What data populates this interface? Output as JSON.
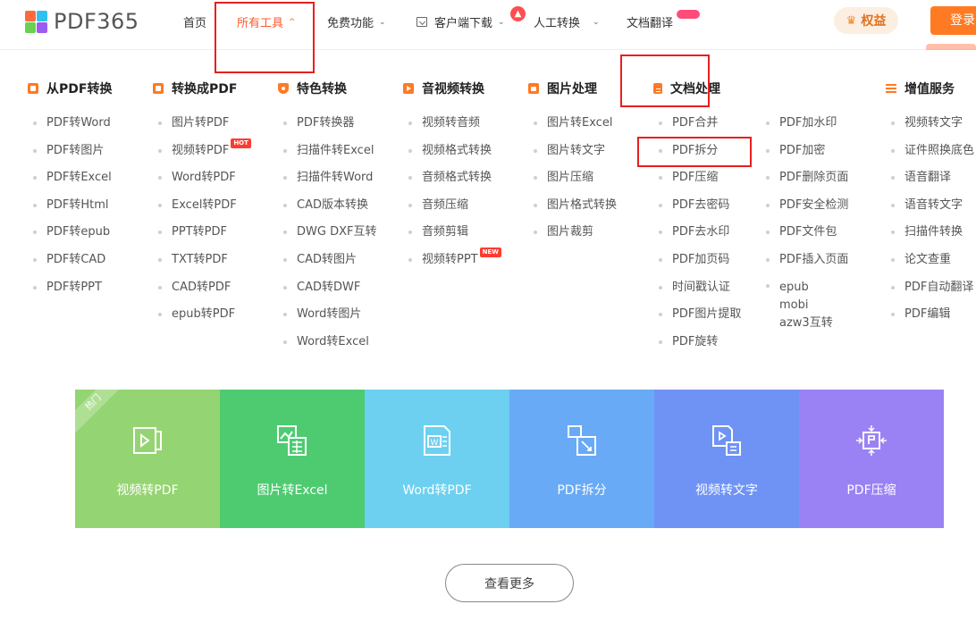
{
  "brand": {
    "name": "PDF365",
    "logo_colors": [
      "#ff6a3d",
      "#2ec1f0",
      "#6ad04e",
      "#9b5cf0"
    ]
  },
  "nav": {
    "home": "首页",
    "all_tools": "所有工具",
    "free": "免费功能",
    "client_download": "客户端下载",
    "manual": "人工转换",
    "doc_translate": "文档翻译",
    "rights": "权益",
    "login": "登录"
  },
  "categories": [
    {
      "name": "从PDF转换",
      "icon": "from-pdf-icon",
      "items": [
        "PDF转Word",
        "PDF转图片",
        "PDF转Excel",
        "PDF转Html",
        "PDF转epub",
        "PDF转CAD",
        "PDF转PPT"
      ]
    },
    {
      "name": "转换成PDF",
      "icon": "to-pdf-icon",
      "items": [
        "图片转PDF",
        "视频转PDF",
        "Word转PDF",
        "Excel转PDF",
        "PPT转PDF",
        "TXT转PDF",
        "CAD转PDF",
        "epub转PDF"
      ]
    },
    {
      "name": "特色转换",
      "icon": "shield-icon",
      "items": [
        "PDF转换器",
        "扫描件转Excel",
        "扫描件转Word",
        "CAD版本转换",
        "DWG DXF互转",
        "CAD转图片",
        "CAD转DWF",
        "Word转图片",
        "Word转Excel"
      ]
    },
    {
      "name": "音视频转换",
      "icon": "play-icon",
      "items": [
        "视频转音频",
        "视频格式转换",
        "音频格式转换",
        "音频压缩",
        "音频剪辑",
        "视频转PPT"
      ]
    },
    {
      "name": "图片处理",
      "icon": "image-icon",
      "items": [
        "图片转Excel",
        "图片转文字",
        "图片压缩",
        "图片格式转换",
        "图片裁剪"
      ]
    },
    {
      "name": "文档处理",
      "icon": "document-icon",
      "items": [
        "PDF合并",
        "PDF拆分",
        "PDF压缩",
        "PDF去密码",
        "PDF去水印",
        "PDF加页码",
        "时间戳认证",
        "PDF图片提取",
        "PDF旋转"
      ],
      "items2": [
        "PDF加水印",
        "PDF加密",
        "PDF删除页面",
        "PDF安全检测",
        "PDF文件包",
        "PDF插入页面",
        "epub mobi azw3互转"
      ]
    },
    {
      "name": "增值服务",
      "icon": "list-icon",
      "items": [
        "视频转文字",
        "证件照换底色",
        "语音翻译",
        "语音转文字",
        "扫描件转换",
        "论文查重",
        "PDF自动翻译",
        "PDF编辑"
      ]
    }
  ],
  "tags": {
    "hot": "HOT",
    "new": "NEW"
  },
  "tiles": [
    {
      "label": "视频转PDF",
      "color": "#95d472",
      "icon": "video-to-pdf-icon"
    },
    {
      "label": "图片转Excel",
      "color": "#4ecb71",
      "icon": "image-to-excel-icon"
    },
    {
      "label": "Word转PDF",
      "color": "#6dd0f0",
      "icon": "word-to-pdf-icon"
    },
    {
      "label": "PDF拆分",
      "color": "#69aaf6",
      "icon": "pdf-split-icon"
    },
    {
      "label": "视频转文字",
      "color": "#6f93f5",
      "icon": "video-to-text-icon"
    },
    {
      "label": "PDF压缩",
      "color": "#9a82f4",
      "icon": "pdf-compress-icon"
    }
  ],
  "hot_ribbon": "热门",
  "more_button": "查看更多",
  "accent_color": "#ff7a22"
}
